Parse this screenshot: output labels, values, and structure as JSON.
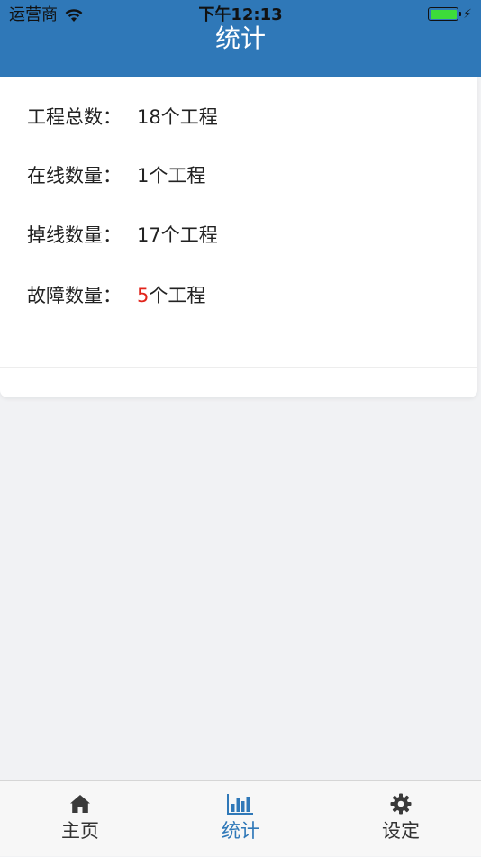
{
  "status_bar": {
    "carrier": "运营商",
    "time": "下午12:13",
    "battery_level": 1.0
  },
  "nav": {
    "title": "统计"
  },
  "stats": [
    {
      "label": "工程总数：",
      "value": "18个工程"
    },
    {
      "label": "在线数量：",
      "value": "1个工程"
    },
    {
      "label": "掉线数量：",
      "value": "17个工程"
    },
    {
      "label": "故障数量：",
      "value_number": "5",
      "value_suffix": "个工程"
    }
  ],
  "tabbar": {
    "tabs": [
      {
        "label": "主页",
        "icon": "home-icon"
      },
      {
        "label": "统计",
        "icon": "bar-chart-icon",
        "active": true
      },
      {
        "label": "设定",
        "icon": "gear-icon"
      }
    ]
  },
  "colors": {
    "header": "#2f78b8",
    "accent": "#2f78b8",
    "alert": "#e1241b",
    "battery": "#3ddc3a"
  }
}
